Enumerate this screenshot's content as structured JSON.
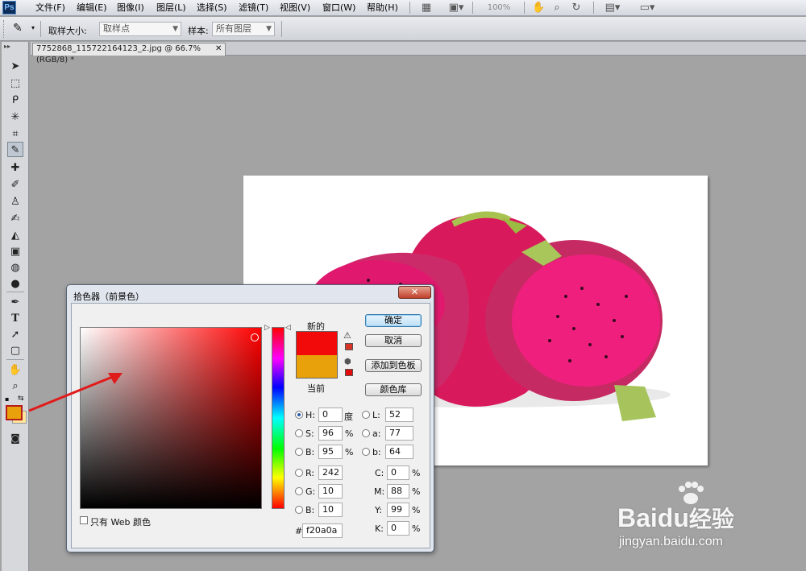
{
  "app": {
    "logo": "Ps"
  },
  "menu": [
    "文件(F)",
    "编辑(E)",
    "图像(I)",
    "图层(L)",
    "选择(S)",
    "滤镜(T)",
    "视图(V)",
    "窗口(W)",
    "帮助(H)"
  ],
  "menubar": {
    "zoom": "100%"
  },
  "options": {
    "sample_size_label": "取样大小:",
    "sample_size_value": "取样点",
    "sample_label": "样本:",
    "sample_value": "所有图层"
  },
  "document": {
    "tab_title": "7752868_115722164123_2.jpg @ 66.7%(RGB/8) *",
    "close": "✕"
  },
  "colors": {
    "foreground": "#e8a10a",
    "new": "#f20a0a",
    "current": "#e8a10a",
    "arrow": "#e01b1b"
  },
  "dialog": {
    "title": "拾色器（前景色）",
    "close": "✕",
    "new_label": "新的",
    "current_label": "当前",
    "buttons": {
      "ok": "确定",
      "cancel": "取消",
      "add_swatch": "添加到色板",
      "libraries": "颜色库"
    },
    "hsb": {
      "h_label": "H:",
      "h": "0",
      "h_unit": "度",
      "s_label": "S:",
      "s": "96",
      "s_unit": "%",
      "b_label": "B:",
      "b": "95",
      "b_unit": "%"
    },
    "rgb": {
      "r_label": "R:",
      "r": "242",
      "g_label": "G:",
      "g": "10",
      "b_label": "B:",
      "b": "10"
    },
    "lab": {
      "l_label": "L:",
      "l": "52",
      "a_label": "a:",
      "a": "77",
      "b_label": "b:",
      "b": "64"
    },
    "cmyk": {
      "c_label": "C:",
      "c": "0",
      "m_label": "M:",
      "m": "88",
      "y_label": "Y:",
      "y": "99",
      "k_label": "K:",
      "k": "0",
      "unit": "%"
    },
    "hex_label": "#",
    "hex": "f20a0a",
    "web_only": "只有 Web 颜色"
  },
  "watermark": {
    "brand": "Bai",
    "brand2": "du",
    "cn": "经验",
    "url": "jingyan.baidu.com"
  }
}
